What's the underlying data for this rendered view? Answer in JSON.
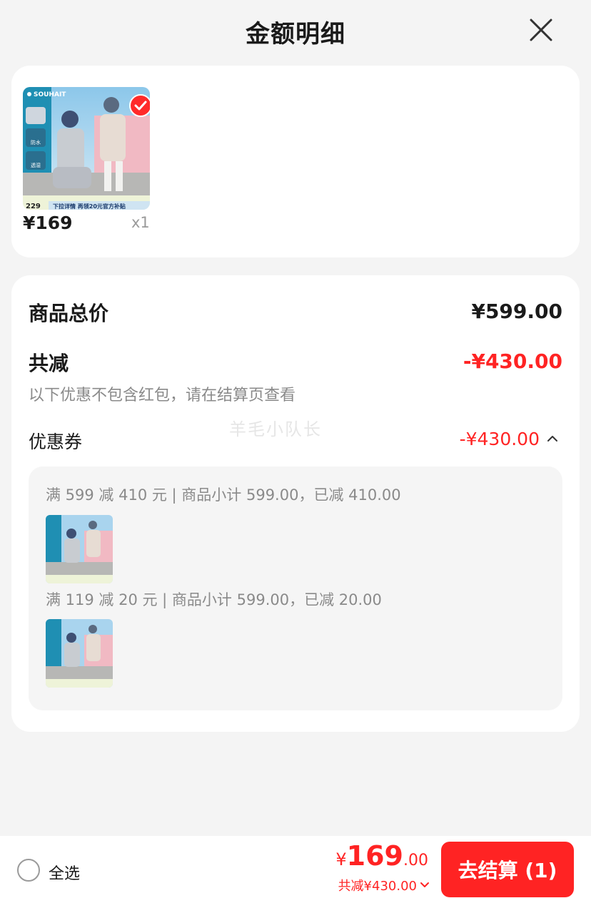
{
  "header": {
    "title": "金额明细"
  },
  "product": {
    "price": "¥169",
    "qty": "x1",
    "thumb": {
      "brand": "SOUHAIT",
      "badges": [
        "防水",
        "透湿"
      ],
      "price_tag": "229",
      "banner": "下拉详情 再领20元官方补贴"
    }
  },
  "summary": {
    "total_label": "商品总价",
    "total_value": "¥599.00",
    "discount_label": "共减",
    "discount_value": "-¥430.00",
    "note": "以下优惠不包含红包，请在结算页查看",
    "watermark": "羊毛小队长",
    "coupon_label": "优惠券",
    "coupon_value": "-¥430.00",
    "coupons": [
      {
        "text": "满 599 减 410 元 | 商品小计 599.00，已减 410.00"
      },
      {
        "text": "满 119 减 20 元 | 商品小计 599.00，已减 20.00"
      }
    ]
  },
  "bottom": {
    "select_all": "全选",
    "yen": "¥",
    "price_int": "169",
    "price_dec": ".00",
    "discount": "共减¥430.00",
    "checkout": "去结算 (1)"
  },
  "colors": {
    "accent": "#ff2323",
    "bg": "#f4f4f4"
  }
}
